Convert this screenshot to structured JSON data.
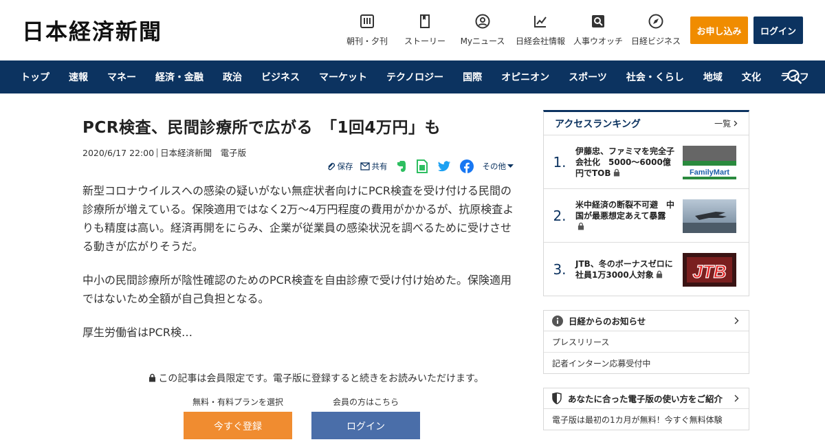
{
  "header": {
    "logo": "日本経済新聞",
    "nav": [
      {
        "label": "朝刊・夕刊",
        "icon": "newspaper-icon"
      },
      {
        "label": "ストーリー",
        "icon": "bookmark-doc-icon"
      },
      {
        "label": "Myニュース",
        "icon": "user-icon"
      },
      {
        "label": "日経会社情報",
        "icon": "chart-trend-icon"
      },
      {
        "label": "人事ウオッチ",
        "icon": "person-search-icon"
      },
      {
        "label": "日経ビジネス",
        "icon": "compass-icon"
      }
    ],
    "apply_label": "お申し込み",
    "login_label": "ログイン"
  },
  "global_nav": [
    "トップ",
    "速報",
    "マネー",
    "経済・金融",
    "政治",
    "ビジネス",
    "マーケット",
    "テクノロジー",
    "国際",
    "オピニオン",
    "スポーツ",
    "社会・くらし",
    "地域",
    "文化",
    "ライフ"
  ],
  "article": {
    "title": "PCR検査、民間診療所で広がる　「1回4万円」も",
    "date": "2020/6/17 22:00",
    "source": "日本経済新聞　電子版",
    "share": {
      "save": "保存",
      "share": "共有",
      "other": "その他"
    },
    "paragraphs": [
      "新型コロナウイルスへの感染の疑いがない無症状者向けにPCR検査を受け付ける民間の診療所が増えている。保険適用ではなく2万～4万円程度の費用がかかるが、抗原検査よりも精度は高い。経済再開をにらみ、企業が従業員の感染状況を調べるために受けさせる動きが広がりそうだ。",
      "中小の民間診療所が陰性確認のためのPCR検査を自由診療で受け付け始めた。保険適用ではないため全額が自己負担となる。",
      "厚生労働省はPCR検…"
    ]
  },
  "paywall": {
    "note": "この記事は会員限定です。電子版に登録すると続きをお読みいただけます。",
    "register_caption": "無料・有料プランを選択",
    "register_label": "今すぐ登録",
    "login_caption": "会員の方はこちら",
    "login_label": "ログイン"
  },
  "ranking": {
    "title": "アクセスランキング",
    "more": "一覧",
    "items": [
      {
        "rank": "1.",
        "text": "伊藤忠、ファミマを完全子会社化　5000～6000億円でTOB",
        "thumb_text": "FamilyMart"
      },
      {
        "rank": "2.",
        "text": "米中経済の断裂不可避　中国が最悪想定あえて暴露",
        "thumb_text": ""
      },
      {
        "rank": "3.",
        "text": "JTB、冬のボーナスゼロに　社員1万3000人対象",
        "thumb_text": "JTB"
      }
    ]
  },
  "notices": {
    "title": "日経からのお知らせ",
    "items": [
      "プレスリリース",
      "記者インターン応募受付中"
    ]
  },
  "guide": {
    "title": "あなたに合った電子版の使い方をご紹介",
    "items": [
      "電子版は最初の1カ月が無料！今すぐ無料体験"
    ]
  },
  "colors": {
    "navy": "#0c3360",
    "orange": "#f08c00",
    "register": "#f08c30",
    "login_blue": "#4a6ea9"
  }
}
